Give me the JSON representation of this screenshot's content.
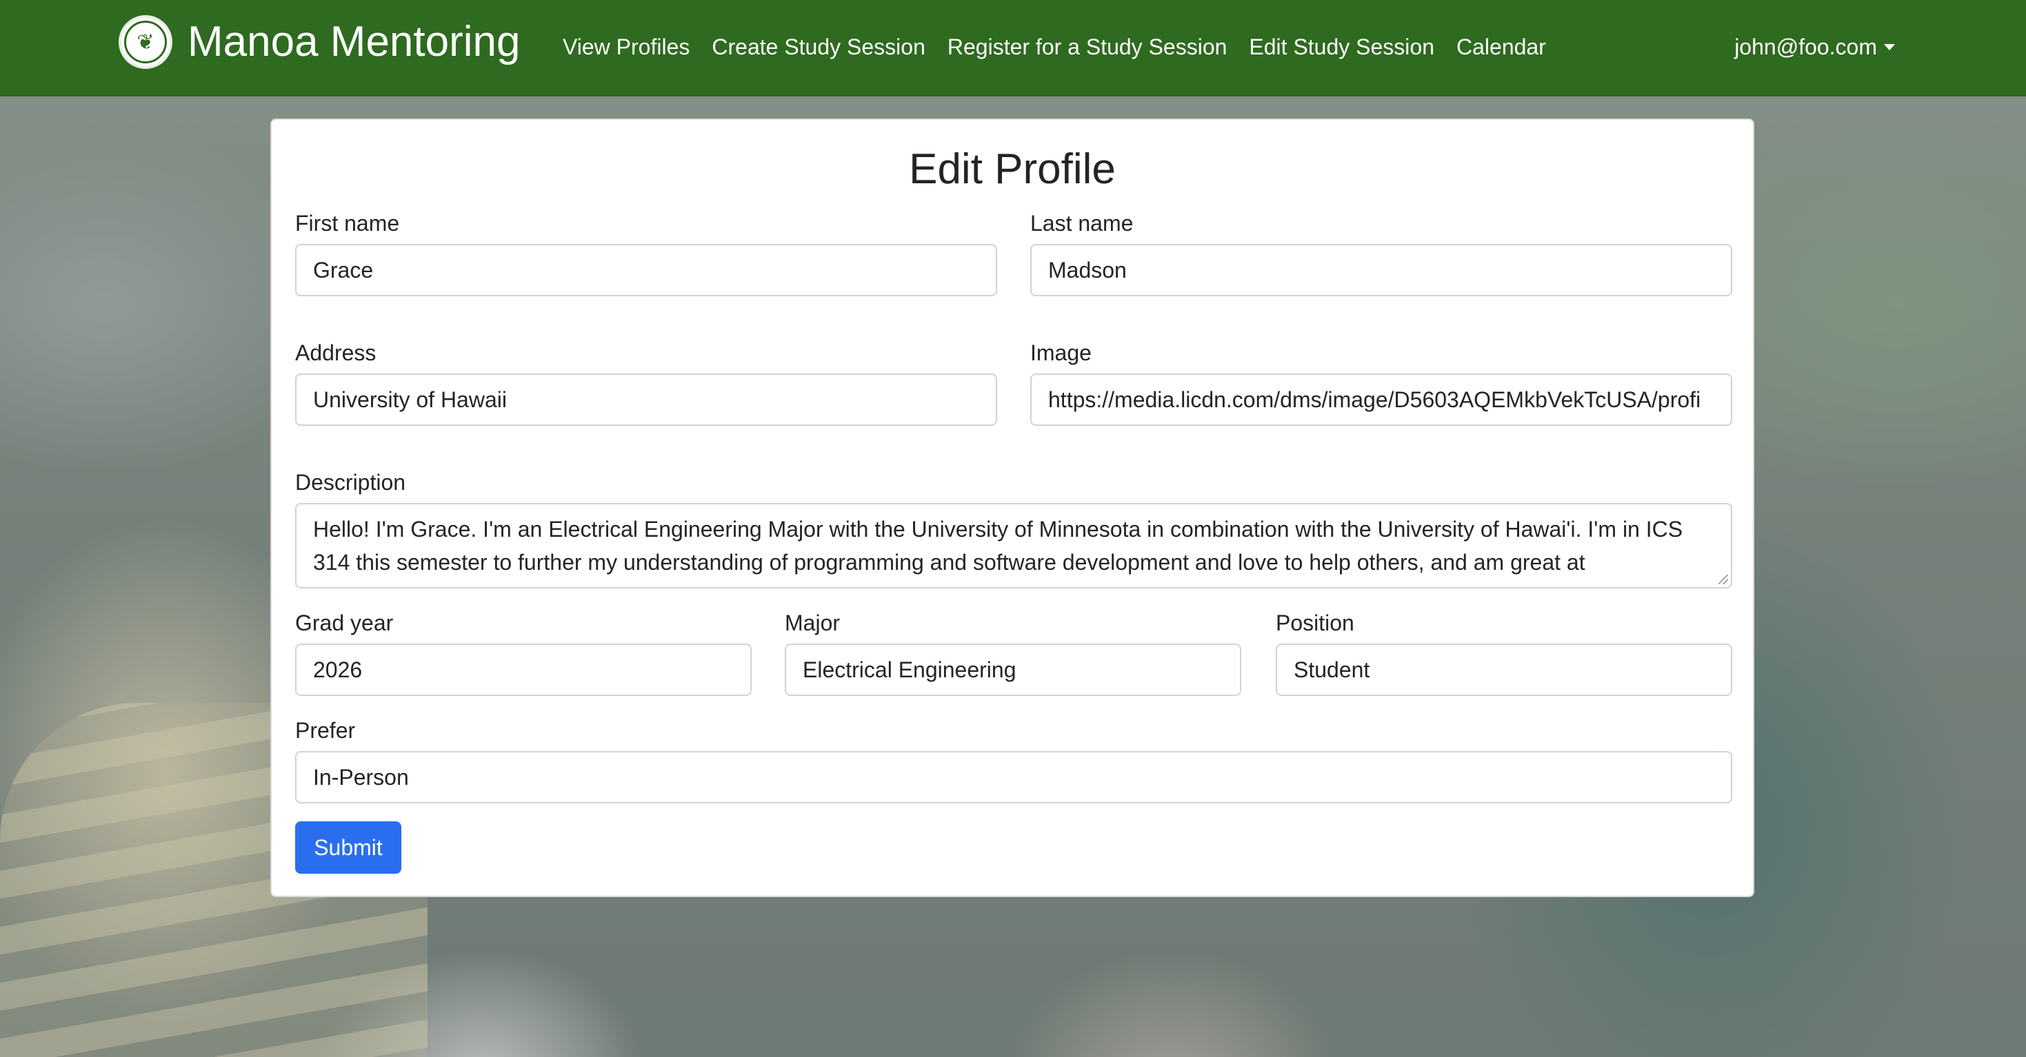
{
  "navbar": {
    "brand": "Manoa Mentoring",
    "links": [
      "View Profiles",
      "Create Study Session",
      "Register for a Study Session",
      "Edit Study Session",
      "Calendar"
    ],
    "user": "john@foo.com"
  },
  "form": {
    "title": "Edit Profile",
    "first_name": {
      "label": "First name",
      "value": "Grace"
    },
    "last_name": {
      "label": "Last name",
      "value": "Madson"
    },
    "address": {
      "label": "Address",
      "value": "University of Hawaii"
    },
    "image": {
      "label": "Image",
      "value": "https://media.licdn.com/dms/image/D5603AQEMkbVekTcUSA/profi"
    },
    "description": {
      "label": "Description",
      "value": "Hello! I'm Grace. I'm an Electrical Engineering Major with the University of Minnesota in combination with the University of Hawai'i. I'm in ICS 314 this semester to further my understanding of programming and software development and love to help others, and am great at"
    },
    "grad_year": {
      "label": "Grad year",
      "value": "2026"
    },
    "major": {
      "label": "Major",
      "value": "Electrical Engineering"
    },
    "position": {
      "label": "Position",
      "value": "Student"
    },
    "prefer": {
      "label": "Prefer",
      "value": "In-Person"
    },
    "submit_label": "Submit"
  }
}
